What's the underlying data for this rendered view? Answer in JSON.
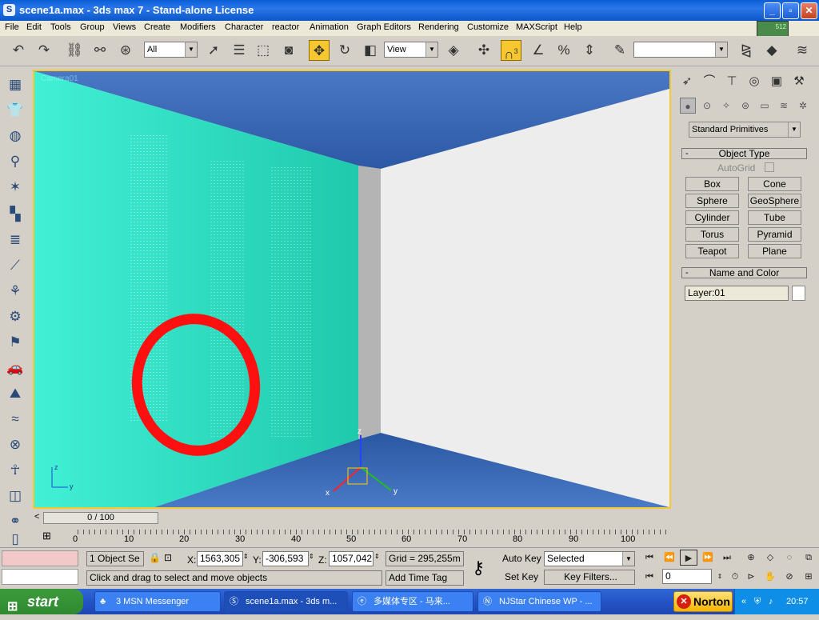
{
  "window": {
    "app_icon": "3ds-max-icon",
    "title": "scene1a.max - 3ds max 7 - Stand-alone License",
    "buttons": {
      "minimize": "_",
      "maximize": "▫",
      "close": "✕"
    }
  },
  "menu": [
    "File",
    "Edit",
    "Tools",
    "Group",
    "Views",
    "Create",
    "Modifiers",
    "Character",
    "reactor",
    "Animation",
    "Graph Editors",
    "Rendering",
    "Customize",
    "MAXScript",
    "Help"
  ],
  "toolbar": {
    "selection_filter": "All",
    "reference_coord": "View",
    "snap_badge": "3",
    "named_selection": "",
    "memory_meter": "512"
  },
  "viewport": {
    "label": "Camera01",
    "axis_labels": {
      "z": "z",
      "x": "x",
      "y": "y"
    }
  },
  "time": {
    "slider": "0 / 100",
    "prev": "<",
    "next": ">",
    "ticks": [
      "0",
      "10",
      "20",
      "30",
      "40",
      "50",
      "60",
      "70",
      "80",
      "90",
      "100"
    ]
  },
  "command_panel": {
    "tabs": [
      "create-tab",
      "modify-tab",
      "hierarchy-tab",
      "motion-tab",
      "display-tab",
      "utilities-tab"
    ],
    "subcategories": [
      "geometry",
      "shapes",
      "lights",
      "cameras",
      "helpers",
      "space-warps",
      "systems"
    ],
    "category_dropdown": "Standard Primitives",
    "object_type": {
      "header": "Object Type",
      "autogrid": "AutoGrid",
      "buttons": [
        "Box",
        "Cone",
        "Sphere",
        "GeoSphere",
        "Cylinder",
        "Tube",
        "Torus",
        "Pyramid",
        "Teapot",
        "Plane"
      ]
    },
    "name_color": {
      "header": "Name and Color",
      "name": "Layer:01",
      "color": "#ffffff"
    }
  },
  "status": {
    "selection": "1 Object Se",
    "x_label": "X:",
    "x_value": "1563,305",
    "y_label": "Y:",
    "y_value": "-306,593",
    "z_label": "Z:",
    "z_value": "1057,042",
    "grid": "Grid = 295,255m",
    "prompt": "Click and drag to select and move objects",
    "add_time_tag": "Add Time Tag",
    "auto_key": "Auto Key",
    "set_key": "Set Key",
    "key_mode": "Selected",
    "key_filters": "Key Filters...",
    "frame": "0"
  },
  "taskbar": {
    "start": "start",
    "items": [
      {
        "label": "3 MSN Messenger",
        "icon": "msn-icon"
      },
      {
        "label": "scene1a.max - 3ds m...",
        "icon": "3ds-max-icon"
      },
      {
        "label": "多媒体专区 - 马来...",
        "icon": "ie-icon"
      },
      {
        "label": "NJStar Chinese WP - ...",
        "icon": "njstar-icon"
      }
    ],
    "norton": "Norton",
    "clock": "20:57"
  },
  "colors": {
    "accent_active": "#f7c72f",
    "annotation_circle": "#ff1010",
    "wall_left": "#34e0c6",
    "ceiling": "#3a67b0",
    "wall_right": "#ececec"
  }
}
